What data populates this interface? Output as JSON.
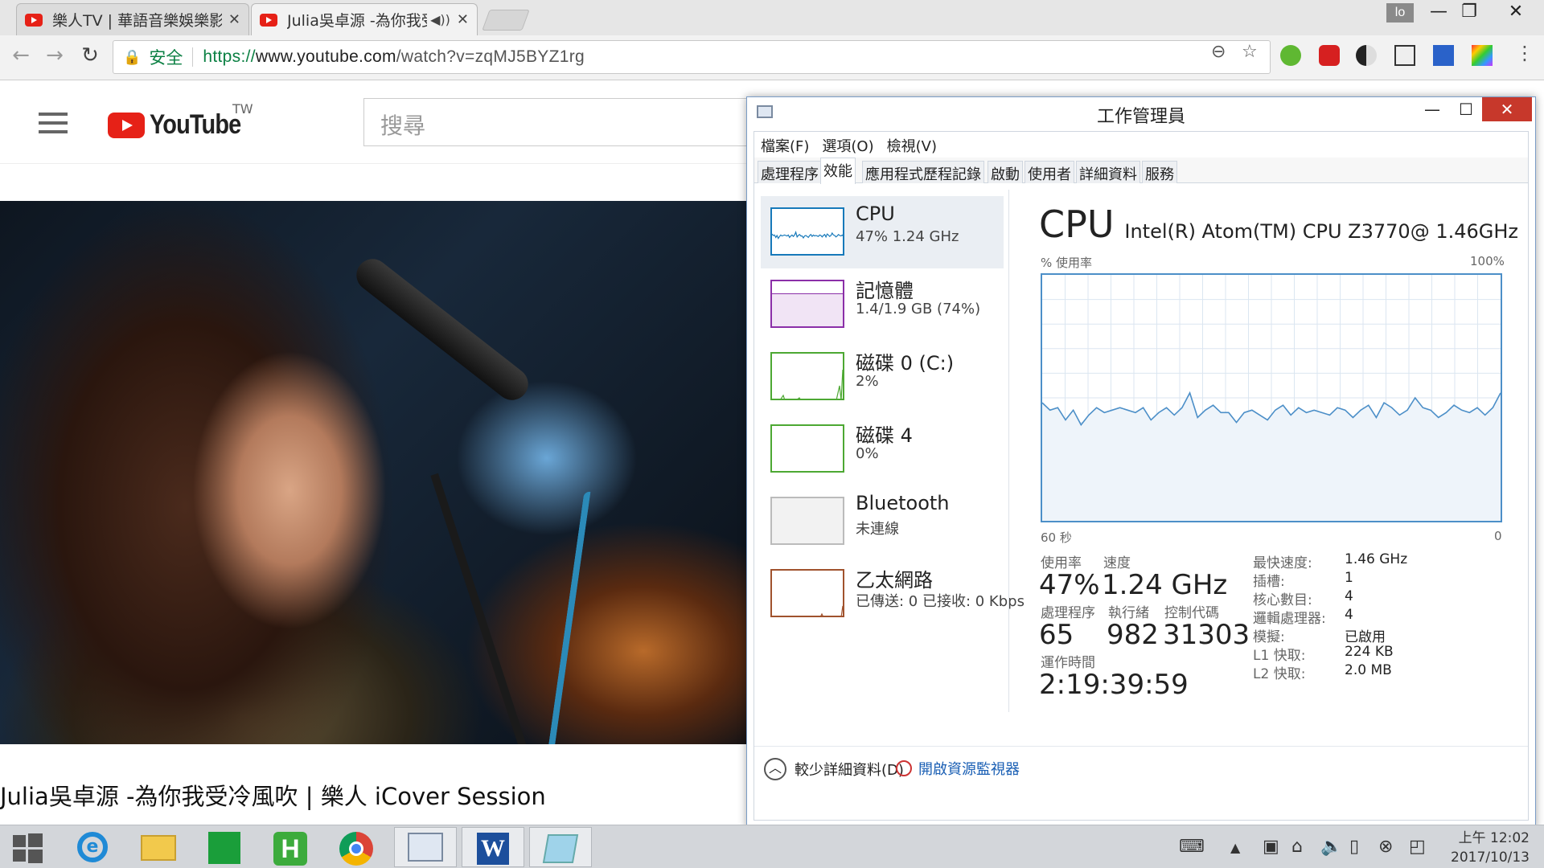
{
  "browser": {
    "tabs": [
      {
        "title": "樂人TV | 華語音樂娛樂影",
        "close": "✕"
      },
      {
        "title": "Julia吳卓源 -為你我受",
        "close": "✕",
        "audio": "◀))"
      }
    ],
    "profile_label": "lo",
    "window_controls": {
      "minimize": "—",
      "restore": "❐",
      "close": "✕"
    },
    "secure_label": "安全",
    "url_scheme": "https://",
    "url_host": "www.youtube.com",
    "url_path": "/watch?v=zqMJ5BYZ1rg"
  },
  "youtube": {
    "logo_text": "YouTube",
    "region": "TW",
    "search_placeholder": "搜尋",
    "video_title": "Julia吳卓源 -為你我受冷風吹 | 樂人 iCover Session"
  },
  "task_manager": {
    "title": "工作管理員",
    "menu": [
      "檔案(F)",
      "選項(O)",
      "檢視(V)"
    ],
    "tabs": [
      "處理程序",
      "效能",
      "應用程式歷程記錄",
      "啟動",
      "使用者",
      "詳細資料",
      "服務"
    ],
    "active_tab": "效能",
    "sidebar": [
      {
        "name": "CPU",
        "value": "47%  1.24 GHz",
        "color": "#1779ba"
      },
      {
        "name": "記憶體",
        "value": "1.4/1.9 GB (74%)",
        "color": "#8b2fa8"
      },
      {
        "name": "磁碟 0 (C:)",
        "value": "2%",
        "color": "#4da833"
      },
      {
        "name": "磁碟 4",
        "value": "0%",
        "color": "#4da833"
      },
      {
        "name": "Bluetooth",
        "value": "未連線",
        "color": "#999999"
      },
      {
        "name": "乙太網路",
        "value": "已傳送: 0  已接收: 0 Kbps",
        "color": "#a0522d"
      }
    ],
    "cpu": {
      "heading": "CPU",
      "model": "Intel(R) Atom(TM) CPU Z3770@ 1.46GHz",
      "graph_label": "% 使用率",
      "graph_max": "100%",
      "graph_time": "60 秒",
      "graph_zero": "0",
      "usage_values": [
        48,
        45,
        46,
        41,
        45,
        39,
        43,
        46,
        44,
        45,
        46,
        45,
        44,
        46,
        41,
        44,
        46,
        43,
        46,
        52,
        42,
        45,
        47,
        44,
        44,
        40,
        44,
        45,
        43,
        41,
        45,
        47,
        43,
        46,
        44,
        45,
        44,
        43,
        46,
        45,
        42,
        45,
        47,
        42,
        48,
        46,
        43,
        45,
        50,
        46,
        45,
        42,
        44,
        47,
        45,
        44,
        46,
        43,
        46,
        52
      ],
      "stats": {
        "usage_label": "使用率",
        "usage": "47%",
        "speed_label": "速度",
        "speed": "1.24 GHz",
        "processes_label": "處理程序",
        "processes": "65",
        "threads_label": "執行緒",
        "threads": "982",
        "handles_label": "控制代碼",
        "handles": "31303",
        "uptime_label": "運作時間",
        "uptime": "2:19:39:59"
      },
      "specs": [
        {
          "k": "最快速度:",
          "v": "1.46 GHz"
        },
        {
          "k": "插槽:",
          "v": "1"
        },
        {
          "k": "核心數目:",
          "v": "4"
        },
        {
          "k": "邏輯處理器:",
          "v": "4"
        },
        {
          "k": "模擬:",
          "v": "已啟用"
        },
        {
          "k": "L1 快取:",
          "v": "224 KB"
        },
        {
          "k": "L2 快取:",
          "v": "2.0 MB"
        }
      ]
    },
    "footer": {
      "fewer_details": "較少詳細資料(D)",
      "resource_monitor": "開啟資源監視器"
    }
  },
  "taskbar": {
    "clock_time": "上午 12:02",
    "clock_date": "2017/10/13"
  }
}
